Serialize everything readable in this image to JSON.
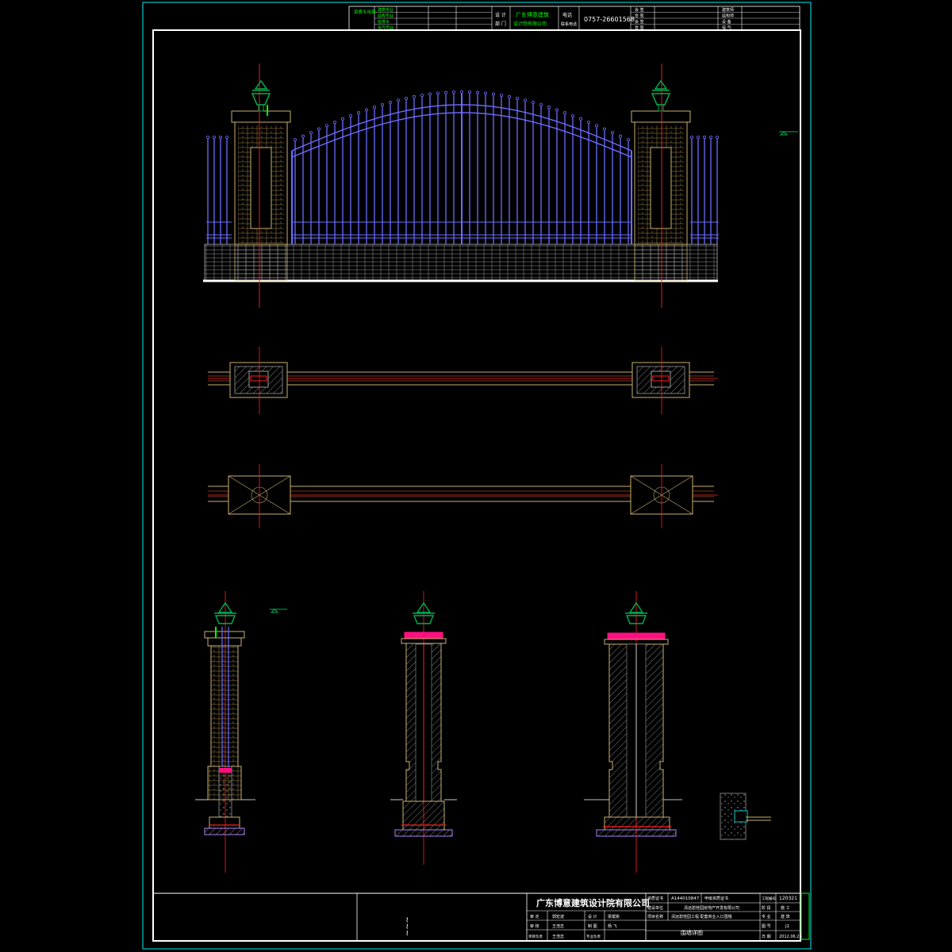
{
  "header": {
    "stamp_label": "资质专用章",
    "row_labels": [
      "建筑专业",
      "结构专业",
      "给排水",
      "电气专业"
    ],
    "design_dept_label": "设 计\n部 门",
    "institute_name_line1": "广东博意建筑",
    "institute_name_line2": "设计院有限公司",
    "contact_label": "电话\n联系电话",
    "phone": "0757-26601568",
    "right_labels_a": [
      "会 签",
      "会 签",
      "会 签",
      "会 签"
    ],
    "right_labels_b": [
      "建筑师",
      "结构师",
      "设 备",
      "电 气"
    ]
  },
  "title_block": {
    "company": "广东博意建筑设计院有限公司",
    "cert_label": "资质证书",
    "cert_no": "A144010847",
    "cert_grade": "甲级资质证书",
    "project_no_label": "工程编号",
    "project_no": "120321",
    "client_label": "建设单位",
    "client": "清远碧桂园房地产开发有限公司",
    "project_label": "项目名称",
    "project": "清远碧桂园工程·配套商业入口围墙",
    "drawing_title": "围墙详图",
    "phase_label": "阶 段",
    "phase": "施 工",
    "discipline_label": "专 业",
    "discipline": "建 筑",
    "sheet_label": "图 号",
    "sheet": "J1",
    "date_label": "日 期",
    "date": "2012.06.25",
    "people_rows": [
      {
        "role1": "审 定",
        "name1": "郭宏波",
        "role2": "设 计",
        "name2": "梁斌彬"
      },
      {
        "role1": "审 核",
        "name1": "王浩志",
        "role2": "制 图",
        "name2": "杨 飞"
      },
      {
        "role1": "项目负责",
        "name1": "王浩志",
        "role2": "专业负责",
        "name2": ""
      }
    ]
  },
  "colors": {
    "border": "#00c8c8",
    "frame": "#ffffff",
    "gate_iron": "#6c6cff",
    "pillar": "#c8b070",
    "brick": "#a08850",
    "axis": "#ff2020",
    "lamp": "#00b050",
    "hatch": "#b0b0b0",
    "cap": "#ff1080",
    "yellow": "#ffe000",
    "green_text": "#00ff00"
  },
  "icons": [
    "lamp-icon",
    "level-marker-icon"
  ]
}
